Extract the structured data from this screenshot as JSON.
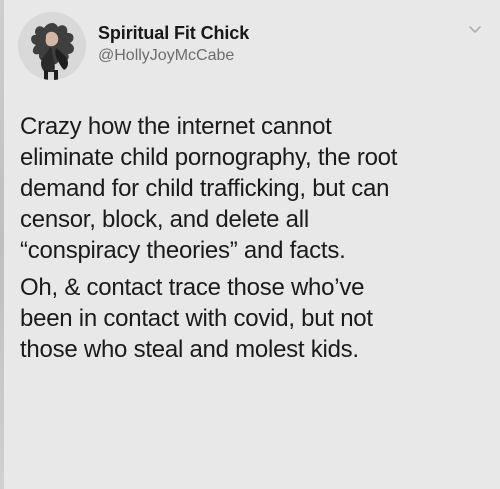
{
  "tweet": {
    "author": {
      "display_name": "Spiritual Fit Chick",
      "handle": "@HollyJoyMcCabe"
    },
    "body_paragraphs": [
      "Crazy how the internet cannot\neliminate child pornography, the root\ndemand for child trafficking, but can\ncensor, block, and delete all\n“conspiracy theories” and facts.",
      "Oh, & contact trace those who’ve\nbeen in contact with covid, but not\nthose who steal and molest kids."
    ]
  },
  "icons": {
    "avatar": "profile-avatar",
    "menu": "chevron-down-icon"
  },
  "colors": {
    "background": "#e8e8e8",
    "text": "#1b1b1b",
    "handle": "#6d6d6d"
  }
}
